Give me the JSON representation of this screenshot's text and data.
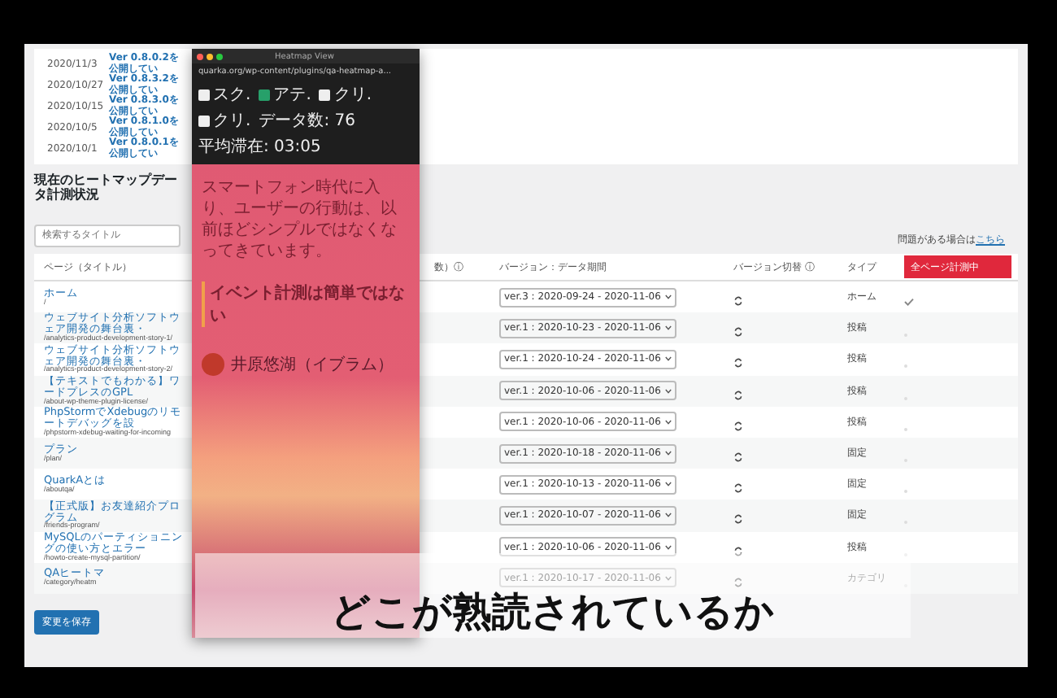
{
  "news": [
    {
      "date": "2020/11/3",
      "title": "Ver 0.8.0.2を公開してい"
    },
    {
      "date": "2020/10/27",
      "title": "Ver 0.8.3.2を公開してい"
    },
    {
      "date": "2020/10/15",
      "title": "Ver 0.8.3.0を公開してい"
    },
    {
      "date": "2020/10/5",
      "title": "Ver 0.8.1.0を公開してい"
    },
    {
      "date": "2020/10/1",
      "title": "Ver 0.8.0.1を公開してい"
    }
  ],
  "section_title": "現在のヒートマップデータ計測状況",
  "search": {
    "placeholder": "検索するタイトル"
  },
  "help_note": {
    "text": "問題がある場合は",
    "link": "こちら"
  },
  "table": {
    "columns": [
      "ページ（タイトル）",
      "数）ⓘ",
      "バージョン：データ期間",
      "バージョン切替 ⓘ",
      "タイプ"
    ],
    "all_pages_button": "全ページ計測中",
    "rows": [
      {
        "title": "ホーム",
        "slug": "/",
        "version": "ver.3 : 2020-09-24 - 2020-11-06",
        "type": "ホーム",
        "checked": true
      },
      {
        "title": "ウェブサイト分析ソフトウェア開発の舞台裏・",
        "slug": "/analytics-product-development-story-1/",
        "version": "ver.1 : 2020-10-23 - 2020-11-06",
        "type": "投稿",
        "checked": false
      },
      {
        "title": "ウェブサイト分析ソフトウェア開発の舞台裏・",
        "slug": "/analytics-product-development-story-2/",
        "version": "ver.1 : 2020-10-24 - 2020-11-06",
        "type": "投稿",
        "checked": false
      },
      {
        "title": "【テキストでもわかる】ワードプレスのGPL",
        "slug": "/about-wp-theme-plugin-license/",
        "version": "ver.1 : 2020-10-06 - 2020-11-06",
        "type": "投稿",
        "checked": false
      },
      {
        "title": "PhpStormでXdebugのリモートデバッグを設",
        "slug": "/phpstorm-xdebug-waiting-for-incoming",
        "version": "ver.1 : 2020-10-06 - 2020-11-06",
        "type": "投稿",
        "checked": false
      },
      {
        "title": "プラン",
        "slug": "/plan/",
        "version": "ver.1 : 2020-10-18 - 2020-11-06",
        "type": "固定",
        "checked": false
      },
      {
        "title": "QuarkAとは",
        "slug": "/aboutqa/",
        "version": "ver.1 : 2020-10-13 - 2020-11-06",
        "type": "固定",
        "checked": false
      },
      {
        "title": "【正式版】お友達紹介プログラム",
        "slug": "/friends-program/",
        "version": "ver.1 : 2020-10-07 - 2020-11-06",
        "type": "固定",
        "checked": false
      },
      {
        "title": "MySQLのパーティショニングの使い方とエラー",
        "slug": "/howto-create-mysql-partition/",
        "version": "ver.1 : 2020-10-06 - 2020-11-06",
        "type": "投稿",
        "checked": false
      },
      {
        "title": "QAヒートマ",
        "slug": "/category/heatm",
        "version": "ver.1 : 2020-10-17 - 2020-11-06",
        "type": "カテゴリ",
        "checked": false
      }
    ]
  },
  "save_button": "変更を保存",
  "heatmap_window": {
    "title": "Heatmap View",
    "url": "quarka.org/wp-content/plugins/qa-heatmap-a...",
    "filters": [
      {
        "label": "スク.",
        "checked": false
      },
      {
        "label": "アテ.",
        "checked": true
      },
      {
        "label": "クリ.",
        "checked": false
      },
      {
        "label": "クリ.",
        "checked": false
      }
    ],
    "data_count": "データ数: 76",
    "avg_stay": "平均滞在: 03:05",
    "paragraph": "スマートフォン時代に入り、ユーザーの行動は、以前ほどシンプルではなくなってきています。",
    "heading": "イベント計測は簡単ではない",
    "tweet_author": "井原悠湖（イブラム）"
  },
  "subtitle": "どこが熟読されているか"
}
